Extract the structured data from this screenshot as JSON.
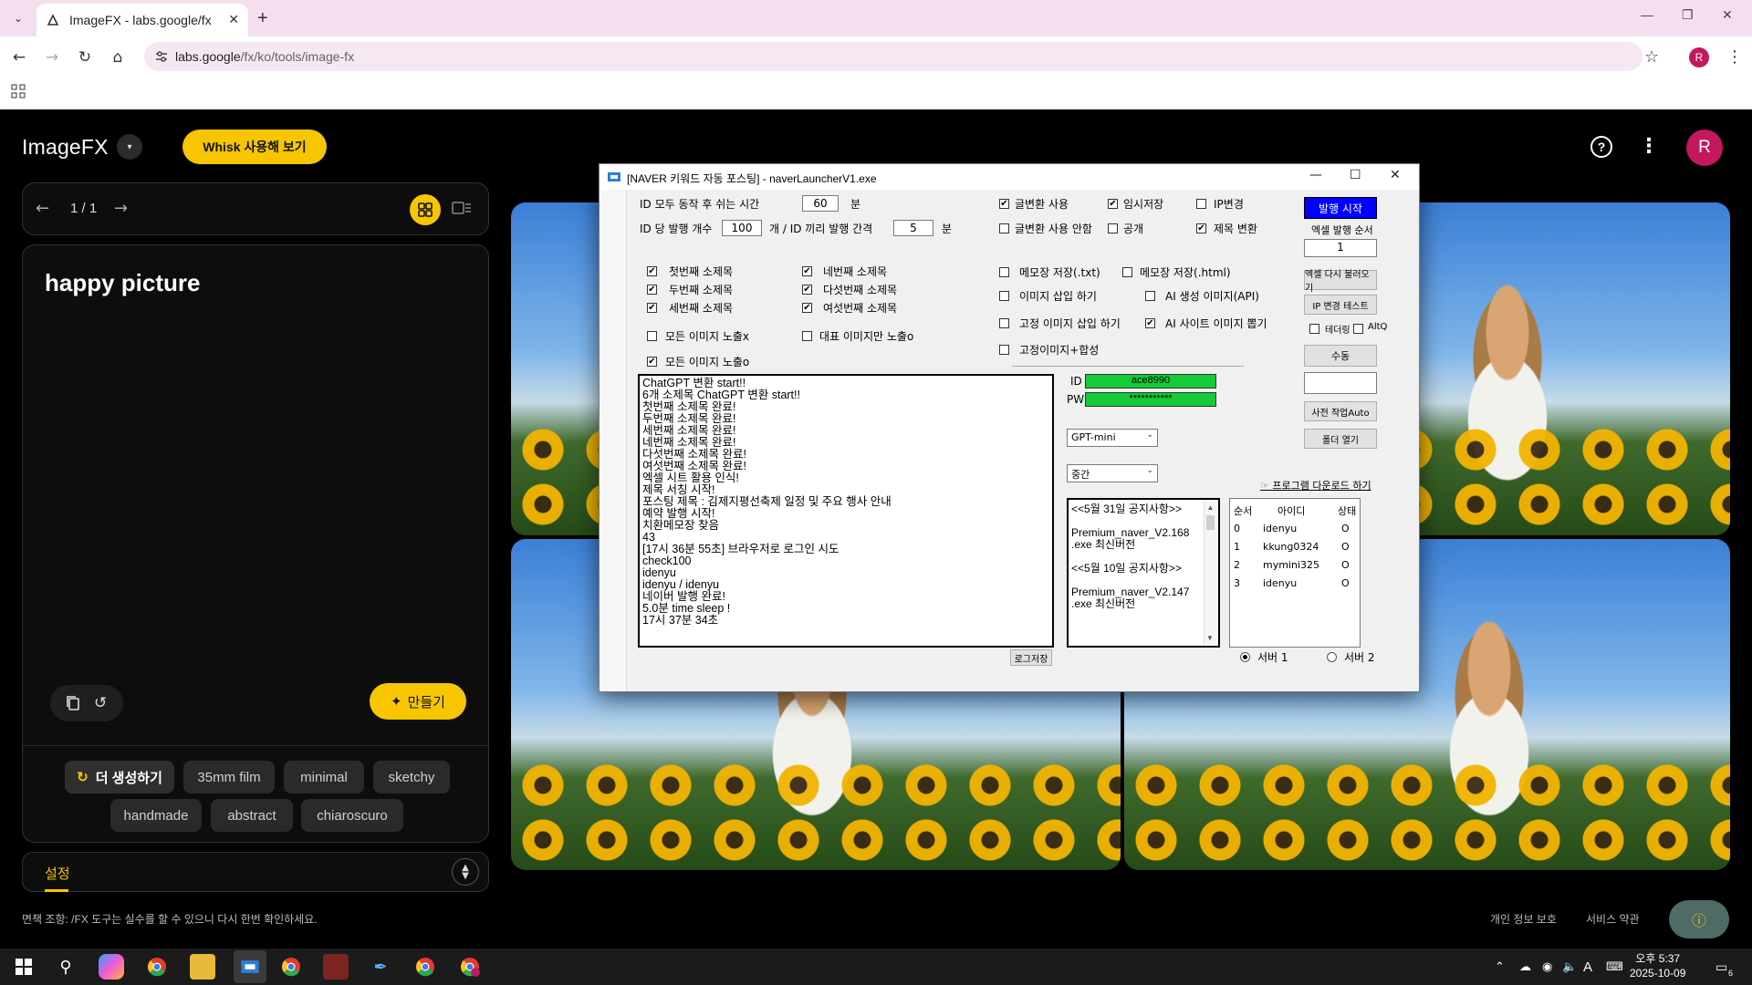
{
  "browser": {
    "tab_title": "ImageFX - labs.google/fx",
    "new_tab": "+",
    "url_host": "labs.google",
    "url_path": "/fx/ko/tools/image-fx",
    "profile_initial": "R"
  },
  "app": {
    "logo": "ImageFX",
    "whisk_button": "Whisk 사용해 보기",
    "avatar_initial": "R",
    "pager": "1 / 1",
    "prompt": "happy picture",
    "make_button": "만들기",
    "chips": [
      "더 생성하기",
      "35mm film",
      "minimal",
      "sketchy",
      "handmade",
      "abstract",
      "chiaroscuro"
    ],
    "settings_label": "설정",
    "disclaimer": "면책 조항: /FX 도구는 실수를 할 수 있으니 다시 한번 확인하세요.",
    "privacy": "개인 정보 보호",
    "terms": "서비스 약관"
  },
  "naver": {
    "title": "[NAVER 키워드 자동 포스팅] - naverLauncherV1.exe",
    "id_rest_label": "ID 모두 동작 후 쉬는 시간",
    "id_rest_value": "60",
    "minute": "분",
    "posts_per_id_label": "ID 당 발행 개수",
    "posts_per_id_value": "100",
    "interval_label": "개 / ID 끼리 발행 간격",
    "interval_value": "5",
    "checks_top": [
      {
        "label": "글변환 사용",
        "checked": true
      },
      {
        "label": "임시저장",
        "checked": true
      },
      {
        "label": "IP변경",
        "checked": false
      },
      {
        "label": "글변환 사용 안함",
        "checked": false
      },
      {
        "label": "공개",
        "checked": false
      },
      {
        "label": "제목 변환",
        "checked": true
      }
    ],
    "subtitles": [
      {
        "label": "첫번째 소제목",
        "checked": true
      },
      {
        "label": "두번째 소제목",
        "checked": true
      },
      {
        "label": "세번째 소제목",
        "checked": true
      },
      {
        "label": "네번째 소제목",
        "checked": true
      },
      {
        "label": "다섯번째 소제목",
        "checked": true
      },
      {
        "label": "여섯번째 소제목",
        "checked": true
      }
    ],
    "img_all_x": "모든 이미지 노출x",
    "img_rep_only": "대표 이미지만 노출o",
    "img_all_o": "모든 이미지 노출o",
    "memo_txt": "메모장 저장(.txt)",
    "memo_html": "메모장 저장(.html)",
    "img_insert": "이미지 삽입 하기",
    "ai_api": "AI 생성 이미지(API)",
    "fixed_img": "고정 이미지 삽입 하기",
    "ai_site": "AI 사이트 이미지 뽑기",
    "fixed_combine": "고정이미지+합성",
    "id_label": "ID",
    "id_value": "ace8990",
    "pw_label": "PW",
    "pw_value": "***********",
    "model_select": "GPT-mini",
    "level_select": "중간",
    "download_link": "프로그램 다운로드 하기",
    "log_save": "로그저장",
    "log_lines": [
      "ChatGPT 변환 start!!",
      "6개 소제목 ChatGPT 변환 start!!",
      "첫번째 소제목 완료!",
      "두번째 소제목 완료!",
      "세번째 소제목 완료!",
      "네번째 소제목 완료!",
      "다섯번째 소제목 완료!",
      "여섯번째 소제목 완료!",
      "엑셀 시트 활용 인식!",
      "제목 서칭 시작!",
      "포스팅 제목 : 김제지평선축제 일정 및 주요 행사 안내",
      "예약 발행 시작!",
      "치환메모장 찾음",
      "43",
      "[17시 36분 55초] 브라우저로 로그인 시도",
      "check100",
      "idenyu",
      "idenyu / idenyu",
      "네이버 발행 완료!",
      "5.0분 time sleep !",
      "17시 37분 34초"
    ],
    "notice_lines": [
      "<<5월 31일 공지사항>>",
      "",
      "Premium_naver_V2.168",
      ".exe 최신버전",
      "",
      "<<5월 10일 공지사항>>",
      "",
      "Premium_naver_V2.147",
      ".exe 최신버전"
    ],
    "right_buttons": {
      "start": "발행 시작",
      "excel_order_label": "엑셀 발행 순서",
      "excel_order_value": "1",
      "excel_reload": "엑셀 다시 불러오기",
      "ip_test": "IP 변경 테스트",
      "tethering": "테더링",
      "alt_q": "AltQ",
      "manual": "수동",
      "pre_auto": "사전 작업Auto",
      "open_folder": "폴더 열기"
    },
    "account_headers": [
      "순서",
      "아이디",
      "상태"
    ],
    "accounts": [
      {
        "idx": "0",
        "id": "idenyu",
        "state": "O"
      },
      {
        "idx": "1",
        "id": "kkung0324",
        "state": "O"
      },
      {
        "idx": "2",
        "id": "mymini325",
        "state": "O"
      },
      {
        "idx": "3",
        "id": "idenyu",
        "state": "O"
      }
    ],
    "server1": "서버 1",
    "server2": "서버 2"
  },
  "taskbar": {
    "time": "오후 5:37",
    "date": "2025-10-09",
    "ime": "A",
    "notif": "6"
  },
  "colors": {
    "accent": "#f7c600",
    "start_button": "#0000ff",
    "green_field": "#13cc37",
    "avatar": "#c3185b"
  }
}
